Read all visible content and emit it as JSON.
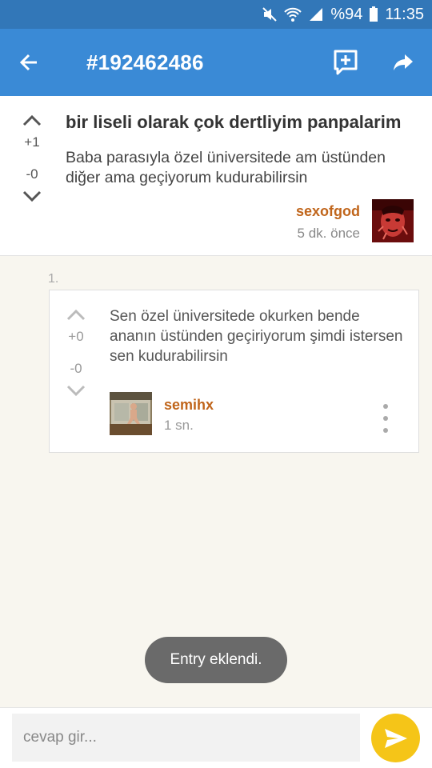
{
  "status_bar": {
    "battery": "%94",
    "time": "11:35",
    "icons": [
      "mute-icon",
      "wifi-icon",
      "signal-icon",
      "battery-icon"
    ]
  },
  "app_bar": {
    "title": "#192462486",
    "icons": [
      "back-arrow-icon",
      "add-comment-icon",
      "share-icon"
    ]
  },
  "topic": {
    "title": "bir liseli olarak çok dertliyim panpalarim",
    "body": "Baba parasıyla özel üniversitede am üstünden diğer ama geçiyorum kudurabilirsin",
    "upvotes": "+1",
    "downvotes": "-0",
    "author": "sexofgod",
    "time": "5 dk. önce"
  },
  "entries": [
    {
      "number": "1.",
      "body": "Sen özel üniversitede okurken bende ananın üstünden geçiriyorum şimdi istersen sen kudurabilirsin",
      "upvotes": "+0",
      "downvotes": "-0",
      "author": "semihx",
      "time": "1 sn."
    }
  ],
  "toast": "Entry eklendi.",
  "reply": {
    "placeholder": "cevap gir..."
  },
  "colors": {
    "status_bar": "#3277b8",
    "app_bar": "#3a8ad6",
    "author": "#c0651b",
    "send_button": "#f5c518",
    "background": "#f8f6ef"
  }
}
